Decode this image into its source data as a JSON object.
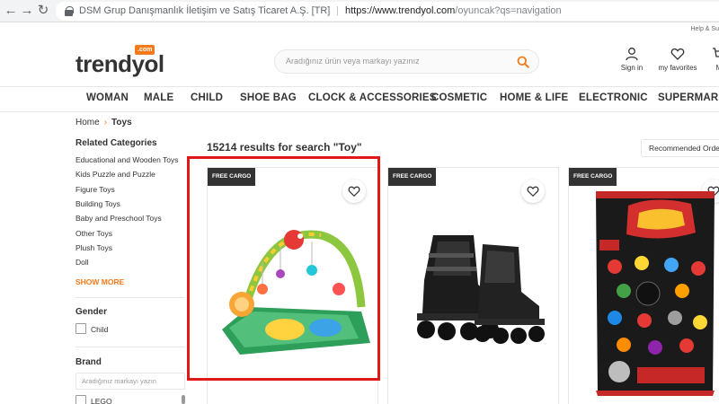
{
  "browser": {
    "back_icon": "arrow-left-icon",
    "forward_icon": "arrow-right-icon",
    "reload_icon": "reload-icon",
    "cert_org": "DSM Grup Danışmanlık İletişim ve Satış Ticaret A.Ş. [TR]",
    "url_host": "https://www.trendyol.com",
    "url_path": "/oyuncak?qs=navigation"
  },
  "header": {
    "help_text": "Help & Su",
    "logo_text": "trendyol",
    "logo_badge": ".com",
    "search_placeholder": "Aradığınız ürün veya markayı yazınız",
    "signin_label": "Sign in",
    "favorites_label": "my favorites",
    "cart_label": "M"
  },
  "categories": [
    "WOMAN",
    "MALE",
    "CHILD",
    "SHOE BAG",
    "CLOCK & ACCESSORIES",
    "COSMETIC",
    "HOME & LIFE",
    "ELECTRONIC",
    "SUPERMARKET"
  ],
  "breadcrumb": {
    "home": "Home",
    "current": "Toys"
  },
  "sidebar": {
    "related_title": "Related Categories",
    "related": [
      "Educational and Wooden Toys",
      "Kids Puzzle and Puzzle",
      "Figure Toys",
      "Building Toys",
      "Baby and Preschool Toys",
      "Other Toys",
      "Plush Toys",
      "Doll"
    ],
    "show_more": "SHOW MORE",
    "gender_title": "Gender",
    "gender_option": "Child",
    "brand_title": "Brand",
    "brand_placeholder": "Aradığınız markayı yazın",
    "brand_option": "LEGO"
  },
  "results": {
    "summary": "15214 results for search \"Toy\"",
    "sort_label": "Recommended Order"
  },
  "products": [
    {
      "badge": "FREE CARGO",
      "image": "baby-play-gym-mat"
    },
    {
      "badge": "FREE CARGO",
      "image": "black-inline-skates"
    },
    {
      "badge": "FREE CARGO",
      "image": "disney-cars-blind-bag"
    }
  ],
  "colors": {
    "brand_orange": "#f27a1a",
    "highlight_red": "#e01818"
  }
}
